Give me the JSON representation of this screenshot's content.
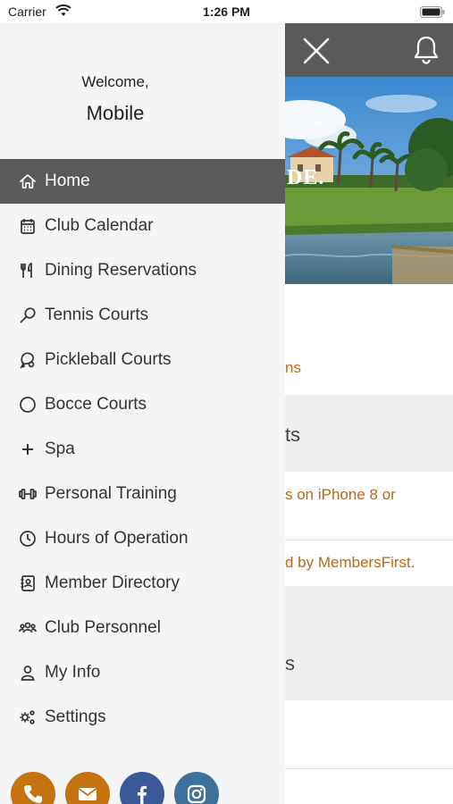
{
  "status_bar": {
    "carrier": "Carrier",
    "time": "1:26 PM"
  },
  "drawer": {
    "welcome_greeting": "Welcome,",
    "user_name": "Mobile",
    "menu": [
      {
        "label": "Home",
        "icon": "home-icon",
        "active": true
      },
      {
        "label": "Club Calendar",
        "icon": "calendar-icon"
      },
      {
        "label": "Dining Reservations",
        "icon": "utensils-icon"
      },
      {
        "label": "Tennis Courts",
        "icon": "tennis-racket-icon"
      },
      {
        "label": "Pickleball Courts",
        "icon": "pickleball-paddle-icon"
      },
      {
        "label": "Bocce Courts",
        "icon": "circle-icon"
      },
      {
        "label": "Spa",
        "icon": "plus-icon"
      },
      {
        "label": "Personal Training",
        "icon": "dumbbell-icon"
      },
      {
        "label": "Hours of Operation",
        "icon": "clock-icon"
      },
      {
        "label": "Member Directory",
        "icon": "address-book-icon"
      },
      {
        "label": "Club Personnel",
        "icon": "users-icon"
      },
      {
        "label": "My Info",
        "icon": "user-icon"
      },
      {
        "label": "Settings",
        "icon": "gears-icon"
      }
    ],
    "socials": [
      {
        "icon": "phone-icon",
        "color": "#c5730f"
      },
      {
        "icon": "envelope-icon",
        "color": "#c5730f"
      },
      {
        "icon": "facebook-icon",
        "color": "#3b5998"
      },
      {
        "icon": "instagram-icon",
        "color": "#3f729b"
      }
    ]
  },
  "background": {
    "hero_text": "DE.",
    "text_gold_1": "ns",
    "text_section_1": "ts",
    "text_gold_2": "s on iPhone 8 or",
    "text_gold_3": "d by MembersFirst.",
    "text_section_2": "s"
  },
  "colors": {
    "header_bg": "#5a5a5a",
    "active_item_bg": "#5a5a5a",
    "drawer_bg": "#f5f5f5",
    "accent_gold": "#b46a1c",
    "phone_circle": "#c5730f",
    "facebook_circle": "#3b5998",
    "instagram_circle": "#3f729b"
  }
}
